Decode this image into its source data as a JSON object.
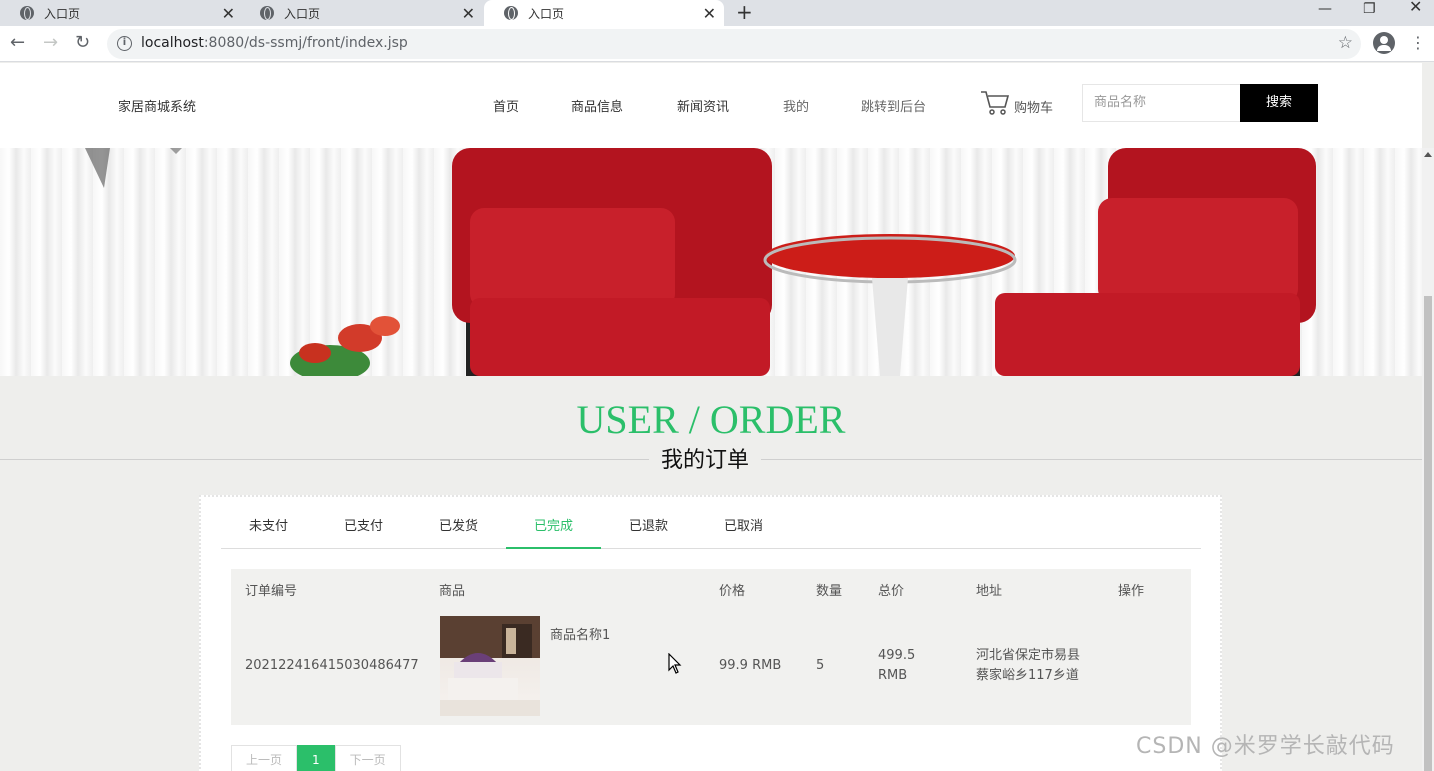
{
  "browser": {
    "tabs": [
      {
        "title": "入口页",
        "active": false
      },
      {
        "title": "入口页",
        "active": false
      },
      {
        "title": "入口页",
        "active": true
      }
    ],
    "url_host": "localhost",
    "url_rest": ":8080/ds-ssmj/front/index.jsp"
  },
  "header": {
    "brand": "家居商城系统",
    "nav": [
      "首页",
      "商品信息",
      "新闻资讯",
      "我的",
      "跳转到后台"
    ],
    "cart_label": "购物车",
    "search_placeholder": "商品名称",
    "search_button": "搜索"
  },
  "section": {
    "title_en": "USER / ORDER",
    "title_cn": "我的订单"
  },
  "order_tabs": {
    "items": [
      "未支付",
      "已支付",
      "已发货",
      "已完成",
      "已退款",
      "已取消"
    ],
    "active_index": 3
  },
  "table": {
    "headers": [
      "订单编号",
      "商品",
      "价格",
      "数量",
      "总价",
      "地址",
      "操作"
    ],
    "rows": [
      {
        "order_no": "20212241641503048647 7",
        "product_name": "商品名称1",
        "price": "99.9 RMB",
        "quantity": "5",
        "total_line1": "499.5",
        "total_line2": "RMB",
        "address_line1": "河北省保定市易县",
        "address_line2": "蔡家峪乡117乡道",
        "action": ""
      }
    ]
  },
  "pager": {
    "prev": "上一页",
    "current": "1",
    "next": "下一页"
  },
  "watermark": "CSDN @米罗学长敲代码",
  "colors": {
    "accent": "#2bbf6a",
    "search_button_bg": "#000000",
    "page_bg": "#eeeeec"
  }
}
